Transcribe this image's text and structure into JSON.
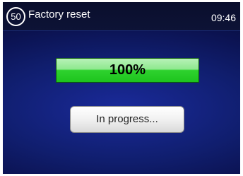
{
  "header": {
    "badge": "50",
    "title": "Factory reset",
    "clock": "09:46"
  },
  "progress": {
    "value": 100,
    "label": "100%",
    "fill_color": "#1ec41e"
  },
  "status_button": {
    "label": "In progress..."
  }
}
